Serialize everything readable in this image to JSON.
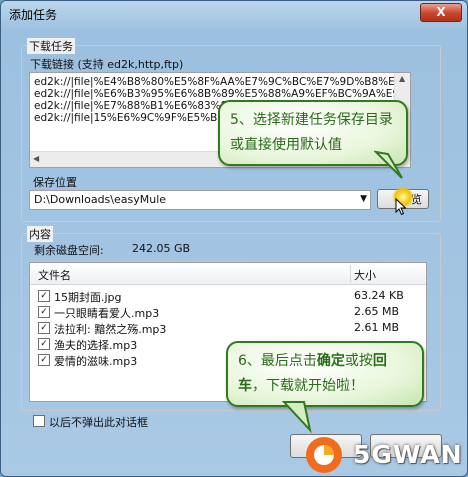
{
  "window": {
    "title": "添加任务",
    "close_label": "X"
  },
  "download_section": {
    "group_label": "下载任务",
    "links_label": "下载链接 (支持 ed2k,http,ftp)",
    "links": [
      "ed2k://|file|%E4%B8%80%E5%8F%AA%E7%9C%BC%E7%9D%B8%E7%9C",
      "ed2k://|file|%E6%B3%95%E6%8B%89%E5%88%A9%EF%BC%9A%E9%BB",
      "ed2k://|file|%E7%88%B1%E6%83%85",
      "ed2k://|file|15%E6%9C%9F%E5%B0"
    ],
    "save_label": "保存位置",
    "save_path": "D:\\Downloads\\easyMule",
    "browse_label": "览"
  },
  "content_section": {
    "group_label": "内容",
    "disk_space_label": "剩余磁盘空间:",
    "disk_space_value": "242.05 GB",
    "columns": {
      "name": "文件名",
      "size": "大小"
    },
    "files": [
      {
        "name": "15期封面.jpg",
        "size": "63.24 KB",
        "checked": true
      },
      {
        "name": "一只眼睛看爱人.mp3",
        "size": "2.65 MB",
        "checked": true
      },
      {
        "name": "法拉利: 黯然之殇.mp3",
        "size": "2.61 MB",
        "checked": true
      },
      {
        "name": "渔夫的选择.mp3",
        "size": "",
        "checked": true
      },
      {
        "name": "爱情的滋味.mp3",
        "size": "",
        "checked": true
      }
    ]
  },
  "footer": {
    "no_popup_label": "以后不弹出此对话框"
  },
  "callouts": {
    "step5": "5、选择新建任务保存目录或直接使用默认值",
    "step6_prefix": "6、最后点击",
    "step6_bold": "确定",
    "step6_mid": "或按",
    "step6_bold2": "回车",
    "step6_suffix": "，下载就开始啦！"
  },
  "watermark": {
    "text": "5GWAN"
  },
  "colors": {
    "accent": "#2f7a1c",
    "title_bar": "#9cc0df",
    "close": "#c8452d"
  }
}
